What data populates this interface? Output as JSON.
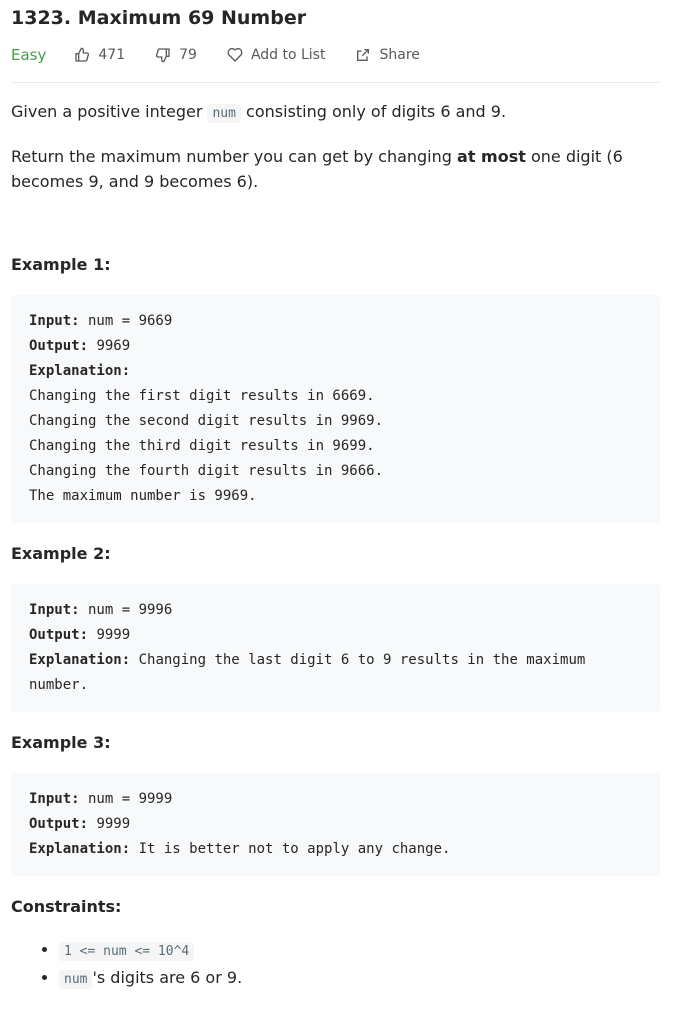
{
  "problem": {
    "title": "1323. Maximum 69 Number",
    "difficulty": "Easy",
    "likes": "471",
    "dislikes": "79",
    "add_to_list": "Add to List",
    "share": "Share"
  },
  "description": {
    "p1_prefix": "Given a positive integer ",
    "p1_code": "num",
    "p1_suffix": " consisting only of digits 6 and 9.",
    "p2_prefix": "Return the maximum number you can get by changing ",
    "p2_bold": "at most",
    "p2_suffix": " one digit (6 becomes 9, and 9 becomes 6)."
  },
  "examples": [
    {
      "heading": "Example 1:",
      "input_label": "Input:",
      "input": " num = 9669",
      "output_label": "Output:",
      "output": " 9969",
      "explanation_label": "Explanation:",
      "explanation": "\nChanging the first digit results in 6669.\nChanging the second digit results in 9969.\nChanging the third digit results in 9699.\nChanging the fourth digit results in 9666.\nThe maximum number is 9969."
    },
    {
      "heading": "Example 2:",
      "input_label": "Input:",
      "input": " num = 9996",
      "output_label": "Output:",
      "output": " 9999",
      "explanation_label": "Explanation:",
      "explanation": " Changing the last digit 6 to 9 results in the maximum number."
    },
    {
      "heading": "Example 3:",
      "input_label": "Input:",
      "input": " num = 9999",
      "output_label": "Output:",
      "output": " 9999",
      "explanation_label": "Explanation:",
      "explanation": " It is better not to apply any change."
    }
  ],
  "constraints": {
    "heading": "Constraints:",
    "c1_code": "1 <= num <= 10^4",
    "c2_code": "num",
    "c2_suffix": "'s digits are 6 or 9."
  },
  "colors": {
    "easy": "#43a047",
    "code_bg": "#f7f9fa"
  }
}
